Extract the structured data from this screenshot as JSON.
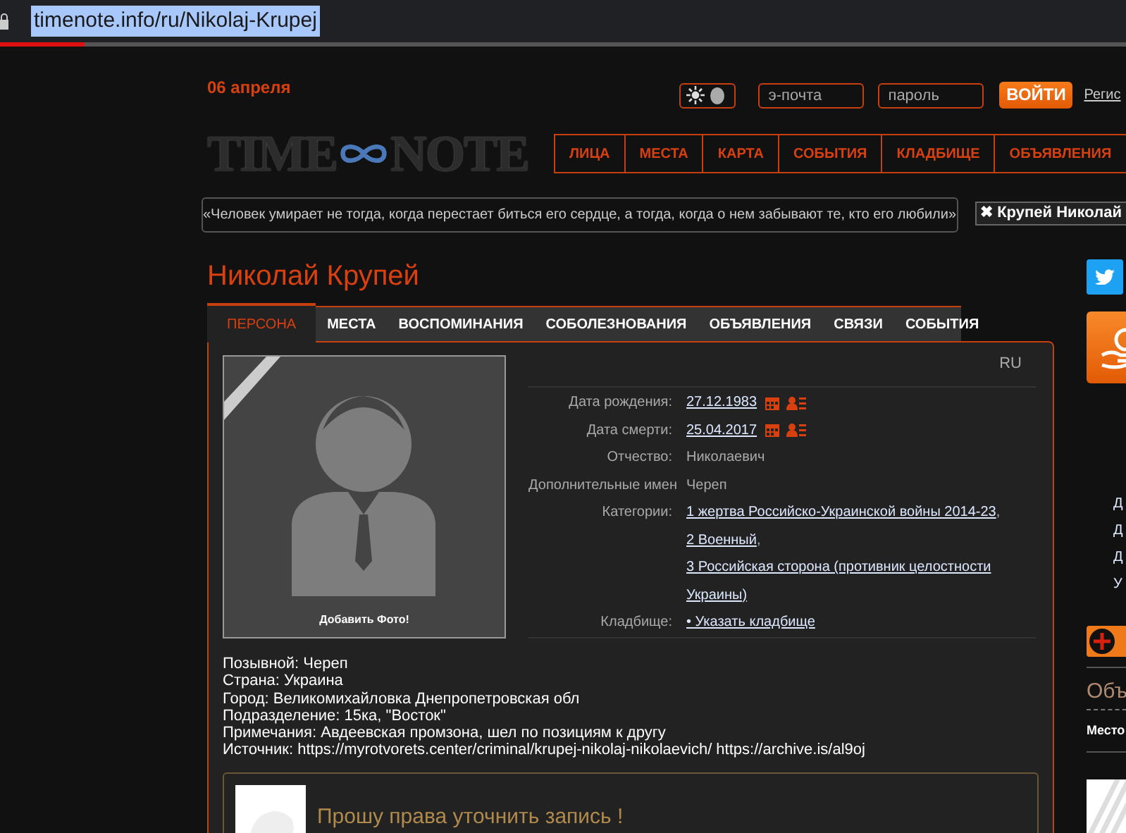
{
  "browser": {
    "url": "timenote.info/ru/Nikolaj-Krupej",
    "loading_bar": {
      "level": 0.075
    }
  },
  "theme_toggle": {
    "on": true
  },
  "header": {
    "date": "06 апреля",
    "email_placeholder": "э-почта",
    "password_placeholder": "пароль",
    "login_button": "ВОЙТИ",
    "register_link": "Регис"
  },
  "logo": {
    "left": "TIME",
    "right": "NOTE"
  },
  "nav": [
    "ЛИЦА",
    "МЕСТА",
    "КАРТА",
    "СОБЫТИЯ",
    "КЛАДБИЩЕ",
    "ОБЪЯВЛЕНИЯ"
  ],
  "quote": "«Человек умирает не тогда, когда перестает биться его сердце, а тогда, когда о нем забывают те, кто его любили»",
  "tag": {
    "icon": "✖",
    "label": "Крупей Николай"
  },
  "person": {
    "name": "Николай Крупей"
  },
  "tabs": [
    {
      "label": "ПЕРСОНА",
      "selected": true
    },
    {
      "label": "МЕСТА",
      "selected": false
    },
    {
      "label": "ВОСПОМИНАНИЯ",
      "selected": false
    },
    {
      "label": "СОБОЛЕЗНОВАНИЯ",
      "selected": false
    },
    {
      "label": "ОБЪЯВЛЕНИЯ",
      "selected": false
    },
    {
      "label": "СВЯЗИ",
      "selected": false
    },
    {
      "label": "СОБЫТИЯ",
      "selected": false
    }
  ],
  "photo": {
    "caption": "Добавить Фото!"
  },
  "language": "RU",
  "fields": [
    {
      "kind": "date",
      "label": "Дата рождения:",
      "value": "27.12.1983"
    },
    {
      "kind": "date",
      "label": "Дата смерти:",
      "value": "25.04.2017"
    },
    {
      "kind": "text",
      "label": "Отчество:",
      "value": "Николаевич"
    },
    {
      "kind": "text",
      "label": "Дополнительные имен",
      "value": "Череп"
    },
    {
      "kind": "links",
      "label": "Категории:",
      "separator": ",",
      "links": [
        "1 жертва Российско-Украинской войны 2014-23",
        "2 Военный",
        "3 Российская сторона (противник целостности Украины)"
      ]
    },
    {
      "kind": "links",
      "label": "Кладбище:",
      "links": [
        "• Указать кладбище"
      ]
    }
  ],
  "bio": [
    "Позывной: Череп",
    "Страна: Украина",
    "Город: Великомихайловка Днепропетровская обл",
    "Подразделение: 15ка, \"Восток\"",
    "Примечания: Авдеевская промзона, шел по позициям к другу",
    "Источник: https://myrotvorets.center/criminal/krupej-nikolaj-nikolaevich/ https://archive.is/al9oj"
  ],
  "request": {
    "text": "Прошу права уточнить запись !"
  },
  "sidebar": {
    "links": [
      "Д",
      "Д",
      "Д",
      "У"
    ],
    "section_title": "Объ",
    "place_label": "Место"
  }
}
